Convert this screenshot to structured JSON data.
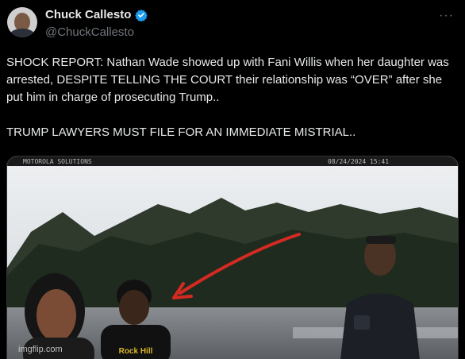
{
  "author": {
    "display_name": "Chuck Callesto",
    "handle": "@ChuckCallesto",
    "verified": true
  },
  "menu_icon": "more-horizontal-icon",
  "tweet": {
    "text": "SHOCK REPORT: Nathan Wade showed up with Fani Willis when her daughter was arrested, DESPITE TELLING THE COURT their relationship was “OVER” after she put him in charge of prosecuting Trump..\n\nTRUMP LAWYERS MUST FILE FOR AN IMMEDIATE MISTRIAL.."
  },
  "media": {
    "camera_brand": "MOTOROLA SOLUTIONS",
    "timestamp": "08/24/2024 15:41",
    "shirt_text": "Rock Hill",
    "arrow_color": "#d42a22"
  },
  "watermark": "imgflip.com",
  "colors": {
    "background": "#000000",
    "text": "#e7e9ea",
    "secondary": "#71767b",
    "verified": "#1d9bf0"
  }
}
